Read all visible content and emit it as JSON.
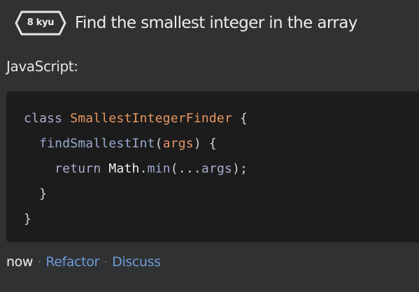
{
  "header": {
    "rank_label": "8 kyu",
    "title": "Find the smallest integer in the array"
  },
  "solution": {
    "language_label": "JavaScript:",
    "code_lines": [
      [
        {
          "text": "class ",
          "kind": "keyword"
        },
        {
          "text": "SmallestIntegerFinder",
          "kind": "class"
        },
        {
          "text": " {",
          "kind": "punct"
        }
      ],
      [
        {
          "text": "  ",
          "kind": "punct"
        },
        {
          "text": "findSmallestInt",
          "kind": "func"
        },
        {
          "text": "(",
          "kind": "punct"
        },
        {
          "text": "args",
          "kind": "param"
        },
        {
          "text": ") {",
          "kind": "punct"
        }
      ],
      [
        {
          "text": "    ",
          "kind": "punct"
        },
        {
          "text": "return ",
          "kind": "keyword"
        },
        {
          "text": "Math",
          "kind": "object"
        },
        {
          "text": ".",
          "kind": "punct"
        },
        {
          "text": "min",
          "kind": "method"
        },
        {
          "text": "(...",
          "kind": "punct"
        },
        {
          "text": "args",
          "kind": "keyword"
        },
        {
          "text": ");",
          "kind": "punct"
        }
      ],
      [
        {
          "text": "  }",
          "kind": "punct"
        }
      ],
      [
        {
          "text": "}",
          "kind": "punct"
        }
      ]
    ]
  },
  "footer": {
    "timestamp": "now",
    "separator": "·",
    "refactor_label": "Refactor",
    "discuss_label": "Discuss"
  },
  "colors": {
    "page_background": "#303133",
    "code_background": "#1c1c1c",
    "link": "#6e9bd8",
    "rank_badge_border": "#e6e6e6"
  },
  "icons": {
    "rank_badge": "hexagon-badge-icon"
  }
}
